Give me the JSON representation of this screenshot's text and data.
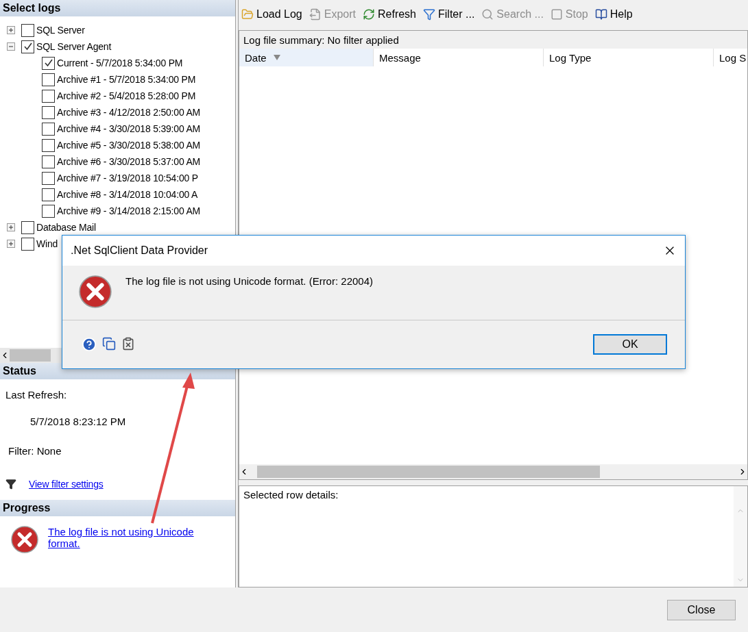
{
  "select_logs": {
    "title": "Select logs",
    "tree": [
      {
        "label": "SQL Server",
        "checked": false,
        "expanded": false
      },
      {
        "label": "SQL Server Agent",
        "checked": true,
        "expanded": true,
        "children": [
          {
            "label": "Current - 5/7/2018 5:34:00 PM",
            "checked": true
          },
          {
            "label": "Archive #1 - 5/7/2018 5:34:00 PM",
            "checked": false
          },
          {
            "label": "Archive #2 - 5/4/2018 5:28:00 PM",
            "checked": false
          },
          {
            "label": "Archive #3 - 4/12/2018 2:50:00 AM",
            "checked": false
          },
          {
            "label": "Archive #4 - 3/30/2018 5:39:00 AM",
            "checked": false
          },
          {
            "label": "Archive #5 - 3/30/2018 5:38:00 AM",
            "checked": false
          },
          {
            "label": "Archive #6 - 3/30/2018 5:37:00 AM",
            "checked": false
          },
          {
            "label": "Archive #7 - 3/19/2018 10:54:00 P",
            "checked": false
          },
          {
            "label": "Archive #8 - 3/14/2018 10:04:00 A",
            "checked": false
          },
          {
            "label": "Archive #9 - 3/14/2018 2:15:00 AM",
            "checked": false
          }
        ]
      },
      {
        "label": "Database Mail",
        "checked": false,
        "expanded": false
      },
      {
        "label": "Wind",
        "checked": false,
        "expanded": false
      }
    ]
  },
  "status": {
    "title": "Status",
    "last_refresh_label": "Last Refresh:",
    "last_refresh": "5/7/2018 8:23:12 PM",
    "filter": "Filter: None",
    "filter_link": "View filter settings"
  },
  "progress": {
    "title": "Progress",
    "message": "The log file is not using Unicode format."
  },
  "toolbar": [
    {
      "kind": "load",
      "label": "Load Log",
      "disabled": false
    },
    {
      "kind": "export",
      "label": "Export",
      "disabled": true
    },
    {
      "kind": "refresh",
      "label": "Refresh",
      "disabled": false
    },
    {
      "kind": "filter",
      "label": "Filter ...",
      "disabled": false
    },
    {
      "kind": "search",
      "label": "Search ...",
      "disabled": true
    },
    {
      "kind": "stop",
      "label": "Stop",
      "disabled": true
    },
    {
      "kind": "help",
      "label": "Help",
      "disabled": false
    }
  ],
  "summary": "Log file summary: No filter applied",
  "columns": [
    {
      "label": "Date",
      "sorted": true
    },
    {
      "label": "Message",
      "sorted": false
    },
    {
      "label": "Log Type",
      "sorted": false
    },
    {
      "label": "Log S",
      "sorted": false
    }
  ],
  "details": {
    "label": "Selected row details:"
  },
  "dialog": {
    "title": ".Net SqlClient Data Provider",
    "message": "The log file is not using Unicode format. (Error: 22004)",
    "ok": "OK"
  },
  "footer": {
    "close": "Close"
  }
}
